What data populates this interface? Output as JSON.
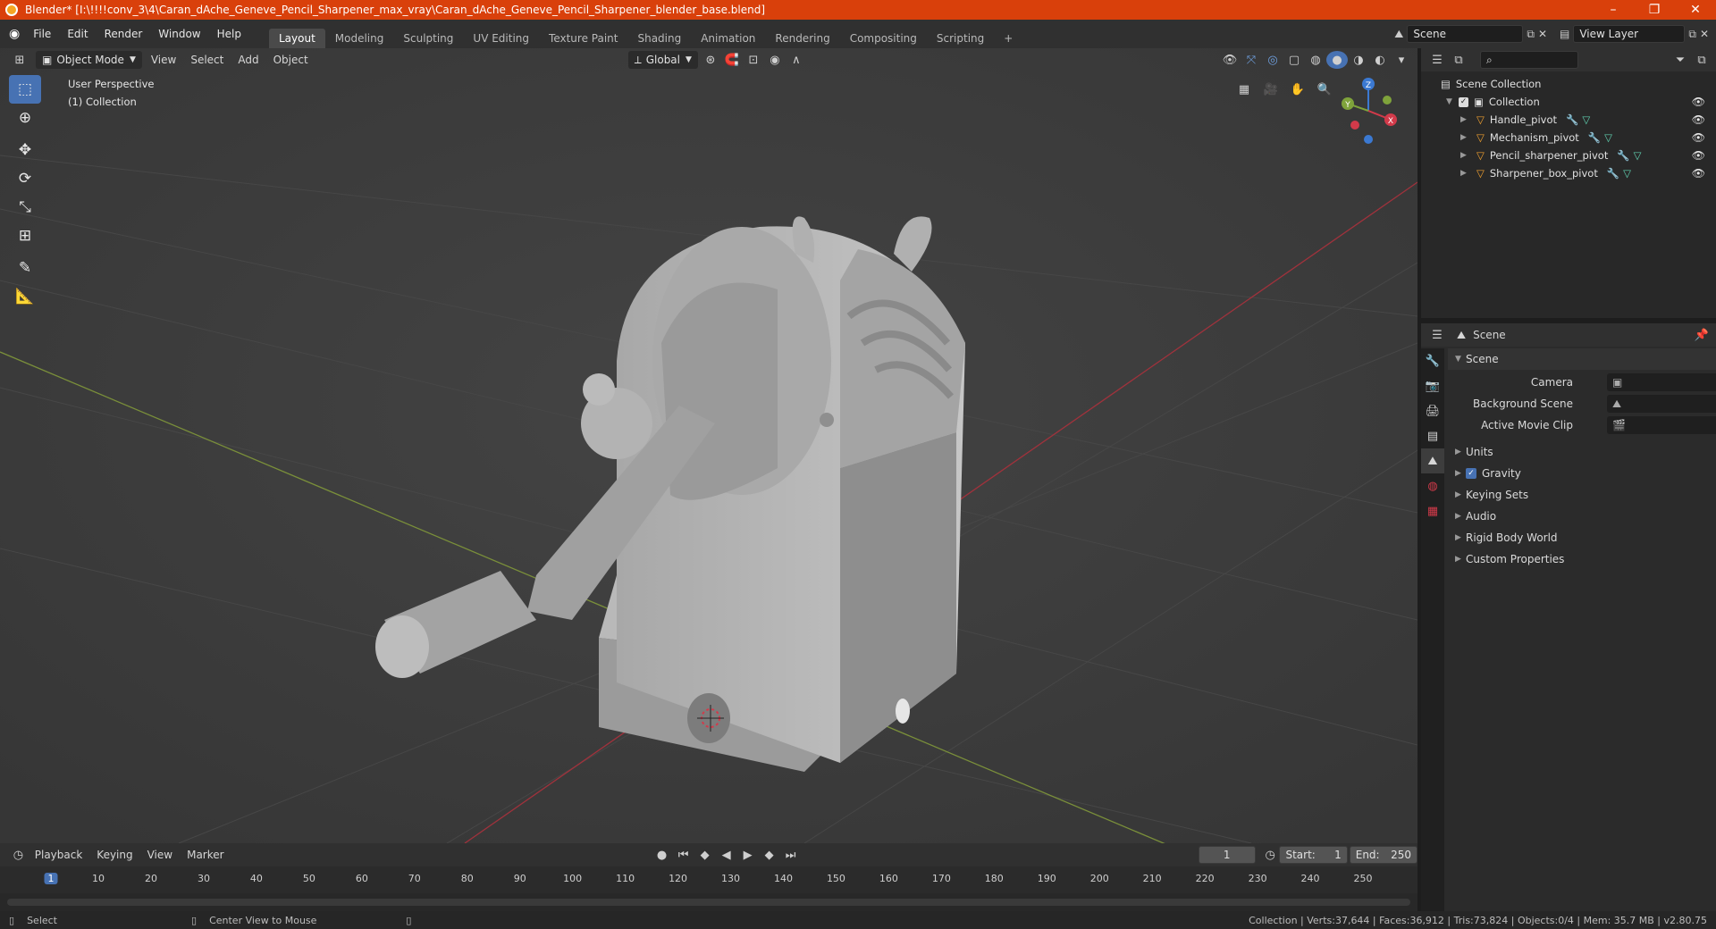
{
  "window": {
    "title": "Blender* [I:\\!!!!conv_3\\4\\Caran_dAche_Geneve_Pencil_Sharpener_max_vray\\Caran_dAche_Geneve_Pencil_Sharpener_blender_base.blend]",
    "min": "–",
    "max": "❐",
    "close": "✕"
  },
  "menu": [
    "File",
    "Edit",
    "Render",
    "Window",
    "Help"
  ],
  "workspaces": [
    "Layout",
    "Modeling",
    "Sculpting",
    "UV Editing",
    "Texture Paint",
    "Shading",
    "Animation",
    "Rendering",
    "Compositing",
    "Scripting"
  ],
  "workspace_add": "+",
  "scene": {
    "name": "Scene",
    "view_layer": "View Layer"
  },
  "viewport": {
    "mode": "Object Mode",
    "menus": [
      "View",
      "Select",
      "Add",
      "Object"
    ],
    "orientation": "Global",
    "overlay_line1": "User Perspective",
    "overlay_line2": "(1) Collection",
    "gizmo": {
      "x": "X",
      "y": "Y",
      "z": "Z"
    }
  },
  "outliner": {
    "root": "Scene Collection",
    "collection": "Collection",
    "items": [
      "Handle_pivot",
      "Mechanism_pivot",
      "Pencil_sharpener_pivot",
      "Sharpener_box_pivot"
    ]
  },
  "properties": {
    "context": "Scene",
    "panel": "Scene",
    "camera_label": "Camera",
    "bg_scene_label": "Background Scene",
    "movie_clip_label": "Active Movie Clip",
    "sections": [
      "Units",
      "Gravity",
      "Keying Sets",
      "Audio",
      "Rigid Body World",
      "Custom Properties"
    ]
  },
  "timeline": {
    "menus": [
      "Playback",
      "Keying",
      "View",
      "Marker"
    ],
    "current_frame": "1",
    "start_label": "Start:",
    "start": "1",
    "end_label": "End:",
    "end": "250",
    "ticks": [
      "1",
      "10",
      "20",
      "30",
      "40",
      "50",
      "60",
      "70",
      "80",
      "90",
      "100",
      "110",
      "120",
      "130",
      "140",
      "150",
      "160",
      "170",
      "180",
      "190",
      "200",
      "210",
      "220",
      "230",
      "240",
      "250"
    ]
  },
  "status": {
    "select": "Select",
    "center_view": "Center View to Mouse",
    "info": "Collection | Verts:37,644 | Faces:36,912 | Tris:73,824 | Objects:0/4 | Mem: 35.7 MB | v2.80.75"
  },
  "colors": {
    "accent": "#4772b3",
    "title": "#d9400b",
    "x_axis": "#d23a4a",
    "y_axis": "#7fa33b",
    "z_axis": "#3b79d2"
  }
}
